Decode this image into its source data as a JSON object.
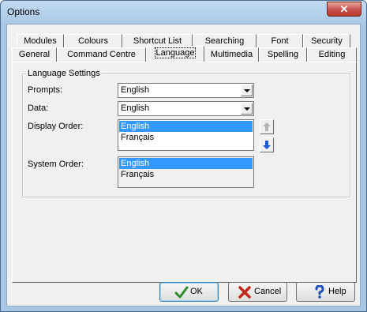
{
  "window": {
    "title": "Options",
    "close_label": "✕"
  },
  "tabs_row1": [
    {
      "label": "Modules"
    },
    {
      "label": "Colours"
    },
    {
      "label": "Shortcut List"
    },
    {
      "label": "Searching"
    },
    {
      "label": "Font"
    },
    {
      "label": "Security"
    }
  ],
  "tabs_row2": [
    {
      "label": "General"
    },
    {
      "label": "Command Centre"
    },
    {
      "label": "Language"
    },
    {
      "label": "Multimedia"
    },
    {
      "label": "Spelling"
    },
    {
      "label": "Editing"
    }
  ],
  "active_tab": "Language",
  "group": {
    "title": "Language Settings"
  },
  "fields": {
    "prompts": {
      "label": "Prompts:",
      "value": "English"
    },
    "data": {
      "label": "Data:",
      "value": "English"
    },
    "display_order": {
      "label": "Display Order:",
      "items": [
        "English",
        "Français"
      ],
      "selected": "English"
    },
    "system_order": {
      "label": "System Order:",
      "items": [
        "English",
        "Français"
      ],
      "selected": "English"
    }
  },
  "icons": {
    "up": "arrow-up-icon",
    "down": "arrow-down-icon",
    "ok": "checkmark-icon",
    "cancel": "x-icon",
    "help": "question-icon"
  },
  "buttons": {
    "ok": "OK",
    "cancel": "Cancel",
    "help": "Help"
  },
  "colors": {
    "selection": "#3399ff",
    "down_arrow": "#1c5bd1",
    "ok_check": "#2e8b2e",
    "cancel_x": "#c0281b",
    "help_q": "#1f4fb4"
  }
}
